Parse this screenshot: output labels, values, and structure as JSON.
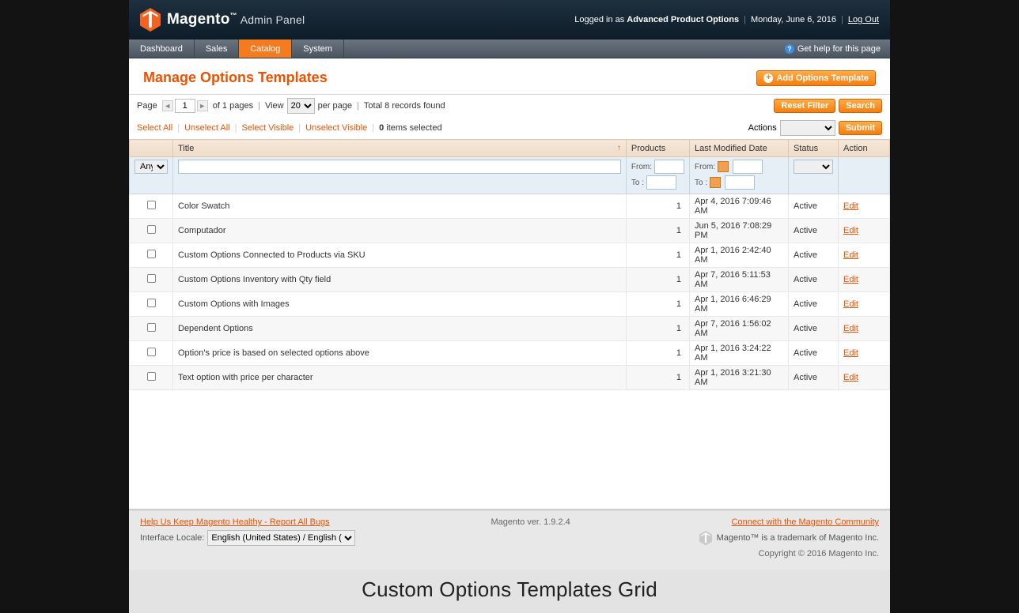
{
  "header": {
    "brand": "Magento",
    "brand_sub": "Admin Panel",
    "logged_in_prefix": "Logged in as",
    "logged_in_user": "Advanced Product Options",
    "date": "Monday, June 6, 2016",
    "logout": "Log Out"
  },
  "nav": {
    "items": [
      "Dashboard",
      "Sales",
      "Catalog",
      "System"
    ],
    "active_index": 2,
    "help": "Get help for this page"
  },
  "page": {
    "title": "Manage Options Templates",
    "add_button": "Add Options Template"
  },
  "toolbar": {
    "page_label": "Page",
    "current_page": "1",
    "total_pages_text": "of 1 pages",
    "view_label": "View",
    "per_page_value": "20",
    "per_page_suffix": "per page",
    "records_text": "Total 8 records found",
    "reset_filter": "Reset Filter",
    "search": "Search"
  },
  "massaction": {
    "select_all": "Select All",
    "unselect_all": "Unselect All",
    "select_visible": "Select Visible",
    "unselect_visible": "Unselect Visible",
    "items_selected_count": "0",
    "items_selected_suffix": "items selected",
    "actions_label": "Actions",
    "submit": "Submit"
  },
  "columns": {
    "title": "Title",
    "products": "Products",
    "last_modified": "Last Modified Date",
    "status": "Status",
    "action": "Action"
  },
  "filters": {
    "any": "Any",
    "from": "From:",
    "to": "To :"
  },
  "rows": [
    {
      "title": "Color Swatch",
      "products": "1",
      "date": "Apr 4, 2016 7:09:46 AM",
      "status": "Active",
      "action": "Edit"
    },
    {
      "title": "Computador",
      "products": "1",
      "date": "Jun 5, 2016 7:08:29 PM",
      "status": "Active",
      "action": "Edit"
    },
    {
      "title": "Custom Options Connected to Products via SKU",
      "products": "1",
      "date": "Apr 1, 2016 2:42:40 AM",
      "status": "Active",
      "action": "Edit"
    },
    {
      "title": "Custom Options Inventory with Qty field",
      "products": "1",
      "date": "Apr 7, 2016 5:11:53 AM",
      "status": "Active",
      "action": "Edit"
    },
    {
      "title": "Custom Options with Images",
      "products": "1",
      "date": "Apr 1, 2016 6:46:29 AM",
      "status": "Active",
      "action": "Edit"
    },
    {
      "title": "Dependent Options",
      "products": "1",
      "date": "Apr 7, 2016 1:56:02 AM",
      "status": "Active",
      "action": "Edit"
    },
    {
      "title": "Option's price is based on selected options above",
      "products": "1",
      "date": "Apr 1, 2016 3:24:22 AM",
      "status": "Active",
      "action": "Edit"
    },
    {
      "title": "Text option with price per character",
      "products": "1",
      "date": "Apr 1, 2016 3:21:30 AM",
      "status": "Active",
      "action": "Edit"
    }
  ],
  "footer": {
    "bugs_link": "Help Us Keep Magento Healthy - Report All Bugs",
    "version": "Magento ver. 1.9.2.4",
    "community_link": "Connect with the Magento Community",
    "locale_label": "Interface Locale:",
    "locale_value": "English (United States) / English (",
    "trademark": "Magento™ is a trademark of Magento Inc.",
    "copyright": "Copyright © 2016 Magento Inc."
  },
  "caption": "Custom Options Templates Grid"
}
